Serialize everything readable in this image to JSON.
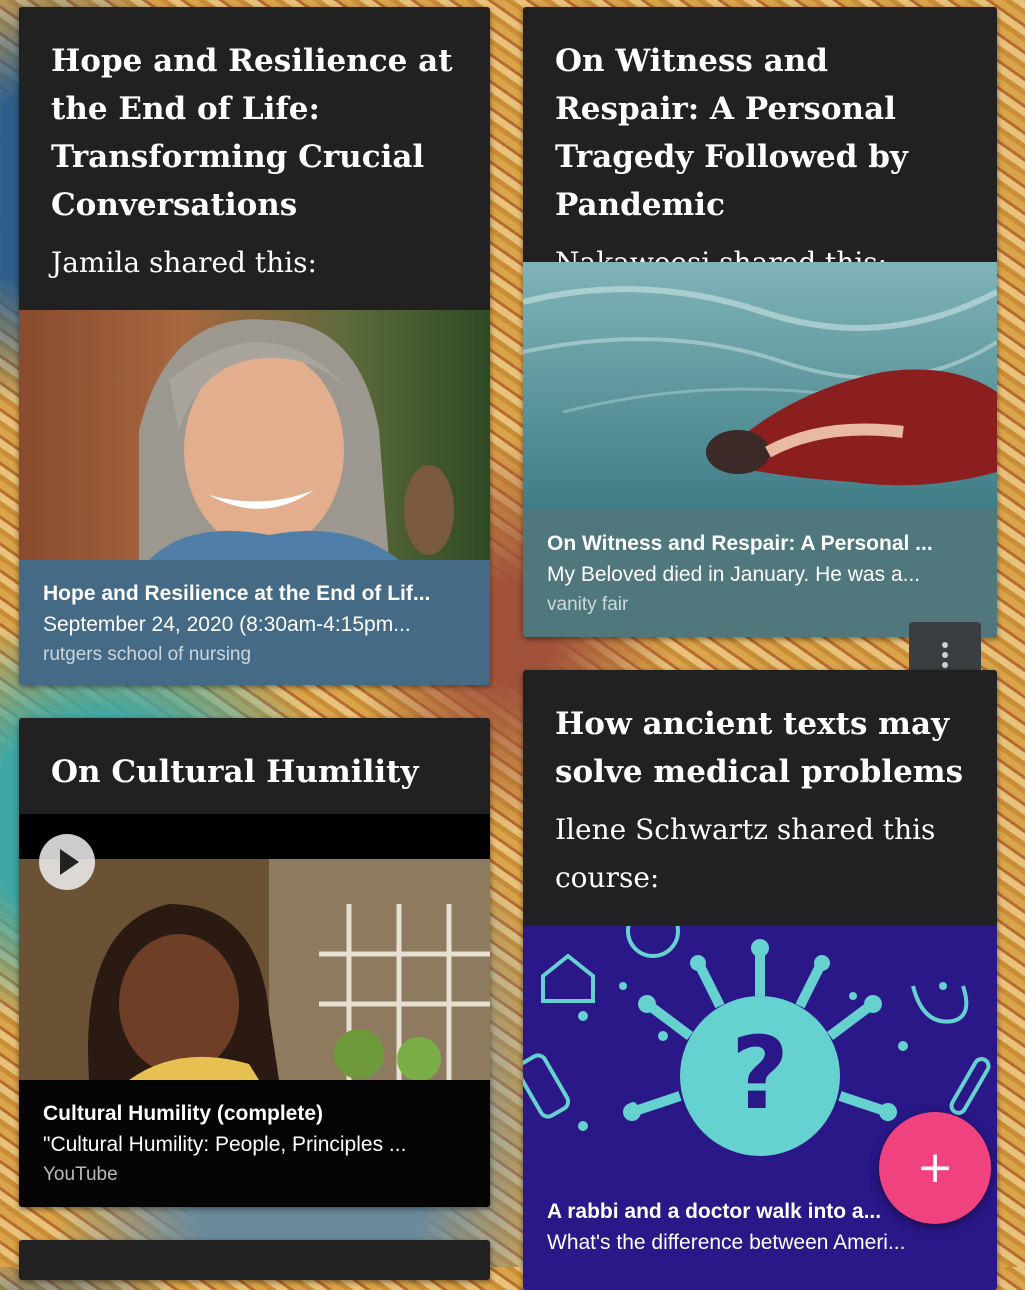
{
  "cards": [
    {
      "title": "Hope and Resilience at the End of Life: Transforming Crucial Conversations",
      "share_text": "Jamila shared this:",
      "link": {
        "title": "Hope and Resilience at the End of Lif...",
        "description": "September 24, 2020 (8:30am-4:15pm...",
        "source": "rutgers school of nursing",
        "color": "#456a85"
      }
    },
    {
      "title": "On Witness and Respair: A Personal Tragedy Followed by Pandemic",
      "share_text": "Nakaweesi shared this:",
      "link": {
        "title": "On Witness and Respair: A Personal ...",
        "description": "My Beloved died in January. He was a...",
        "source": "vanity fair",
        "color": "#4f777c"
      }
    },
    {
      "title": "On Cultural Humility",
      "share_text": "",
      "link": {
        "title": "Cultural Humility (complete)",
        "description": "\"Cultural Humility: People, Principles ...",
        "source": "YouTube",
        "color": "#050505"
      }
    },
    {
      "title": "How ancient texts may solve medical problems",
      "share_text": "Ilene Schwartz shared this course:",
      "link": {
        "title": "A rabbi and a doctor walk into a...",
        "description": "What's the difference between Ameri...",
        "source": "",
        "color": "#2a1788"
      }
    }
  ],
  "icons": {
    "play": "play-icon",
    "more": "more-vert-icon",
    "add": "plus-icon",
    "question_mark": "?"
  },
  "fab_symbol": "+",
  "colors": {
    "card": "#212121",
    "fab": "#f0427e"
  }
}
